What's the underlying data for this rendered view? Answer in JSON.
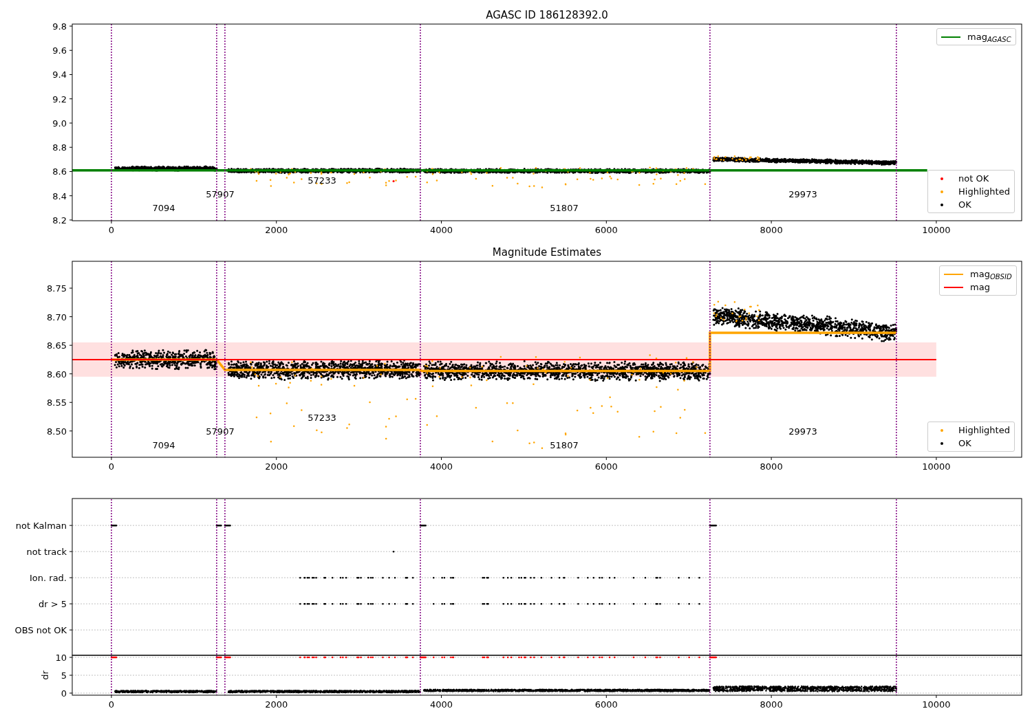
{
  "panels": [
    {
      "chart_data": {
        "type": "scatter",
        "title": "AGASC ID 186128392.0",
        "xlim": [
          -475,
          11035
        ],
        "ylim": [
          8.194,
          9.817
        ],
        "xticks": [
          0,
          2000,
          4000,
          6000,
          8000,
          10000
        ],
        "yticks": [
          8.2,
          8.4,
          8.6,
          8.8,
          {
            "value": 9,
            "label": "9.0"
          },
          9.2,
          9.4,
          9.6,
          9.8
        ],
        "series": [
          {
            "name": "mag$_{AGASC}$",
            "type": "line",
            "color": "#008000",
            "x": [
              -475,
              9890
            ],
            "values": [
              8.61,
              8.61
            ]
          },
          {
            "name": "not OK",
            "type": "scatter",
            "color": "#ff0000"
          },
          {
            "name": "Highlighted",
            "type": "scatter",
            "color": "#ffa500"
          },
          {
            "name": "OK",
            "type": "scatter",
            "color": "#000000"
          }
        ],
        "ref_lines": [
          {
            "axis": "x",
            "value": 0,
            "color": "#800080"
          },
          {
            "axis": "x",
            "value": 1276,
            "color": "#800080"
          },
          {
            "axis": "x",
            "value": 1376,
            "color": "#800080"
          },
          {
            "axis": "x",
            "value": 3745,
            "color": "#800080"
          },
          {
            "axis": "x",
            "value": 7256,
            "color": "#800080"
          },
          {
            "axis": "x",
            "value": 9516,
            "color": "#800080"
          }
        ],
        "annotations": [
          "7094",
          "57907",
          "57233",
          "51807",
          "29973"
        ]
      }
    },
    {
      "chart_data": {
        "type": "scatter",
        "title": "Magnitude Estimates",
        "xlim": [
          -475,
          11035
        ],
        "ylim": [
          8.454,
          8.797
        ],
        "xticks": [
          0,
          2000,
          4000,
          6000,
          8000,
          10000
        ],
        "yticks": [
          {
            "value": 8.5,
            "label": "8.50"
          },
          {
            "value": 8.55,
            "label": "8.55"
          },
          {
            "value": 8.6,
            "label": "8.60"
          },
          {
            "value": 8.65,
            "label": "8.65"
          },
          {
            "value": 8.7,
            "label": "8.70"
          },
          {
            "value": 8.75,
            "label": "8.75"
          }
        ],
        "series": [
          {
            "name": "mag$_{OBSID}$",
            "type": "line",
            "color": "#ffa500",
            "x": [
              0,
              1276,
              1376,
              3745,
              3745,
              7256,
              7256,
              9516
            ],
            "values": [
              8.625,
              8.625,
              8.607,
              8.607,
              8.605,
              8.605,
              8.672,
              8.672
            ]
          },
          {
            "name": "mag",
            "type": "line",
            "color": "#ff0000",
            "x": [
              -475,
              10000
            ],
            "values": [
              8.625,
              8.625
            ]
          },
          {
            "name": "Highlighted",
            "type": "scatter",
            "color": "#ffa500"
          },
          {
            "name": "OK",
            "type": "scatter",
            "color": "#000000"
          }
        ],
        "bands": [
          {
            "axis": "y",
            "from": 8.595,
            "to": 8.655,
            "color": "#ff0000"
          }
        ],
        "ref_lines": [
          {
            "axis": "x",
            "value": 0,
            "color": "#800080"
          },
          {
            "axis": "x",
            "value": 1276,
            "color": "#800080"
          },
          {
            "axis": "x",
            "value": 1376,
            "color": "#800080"
          },
          {
            "axis": "x",
            "value": 3745,
            "color": "#800080"
          },
          {
            "axis": "x",
            "value": 7256,
            "color": "#800080"
          },
          {
            "axis": "x",
            "value": 9516,
            "color": "#800080"
          }
        ],
        "annotations": [
          "7094",
          "57907",
          "57233",
          "51807",
          "29973"
        ]
      }
    },
    {
      "flag_rows": [
        "not Kalman",
        "not track",
        "Ion. rad.",
        "dr > 5",
        "OBS not OK"
      ]
    },
    {
      "chart_data": {
        "type": "scatter",
        "ylabel": "dr",
        "xlim": [
          -475,
          11035
        ],
        "ylim": [
          -0.58,
          10.58
        ],
        "xticks": [
          0,
          2000,
          4000,
          6000,
          8000,
          10000
        ],
        "yticks": [
          0,
          5,
          10
        ],
        "grid": true,
        "ref_lines": [
          {
            "axis": "x",
            "value": 0,
            "color": "#800080"
          },
          {
            "axis": "x",
            "value": 1276,
            "color": "#800080"
          },
          {
            "axis": "x",
            "value": 1376,
            "color": "#800080"
          },
          {
            "axis": "x",
            "value": 3745,
            "color": "#800080"
          },
          {
            "axis": "x",
            "value": 7256,
            "color": "#800080"
          },
          {
            "axis": "x",
            "value": 9516,
            "color": "#800080"
          }
        ]
      }
    }
  ]
}
